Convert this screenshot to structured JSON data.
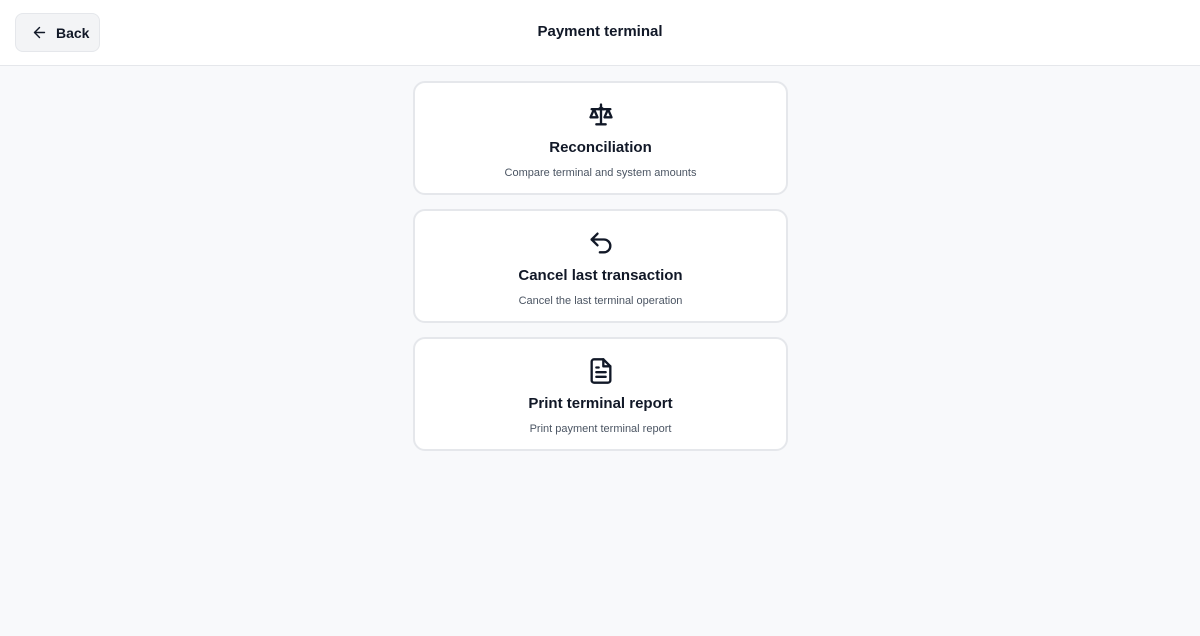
{
  "header": {
    "back_label": "Back",
    "back_icon": "arrow-left-icon",
    "title": "Payment terminal"
  },
  "actions": [
    {
      "icon": "scale-icon",
      "title": "Reconciliation",
      "description": "Compare terminal and system amounts"
    },
    {
      "icon": "undo-icon",
      "title": "Cancel last transaction",
      "description": "Cancel the last terminal operation"
    },
    {
      "icon": "document-icon",
      "title": "Print terminal report",
      "description": "Print payment terminal report"
    }
  ],
  "colors": {
    "background": "#f8f9fb",
    "card_border": "#e5e7eb",
    "text_primary": "#111827",
    "text_secondary": "#4b5563"
  }
}
